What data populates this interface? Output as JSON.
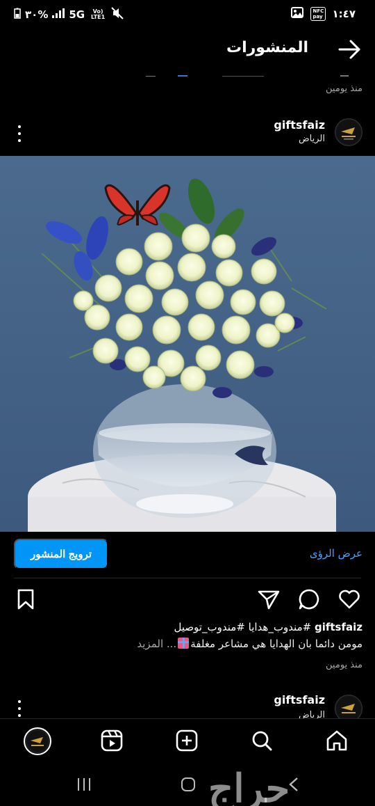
{
  "status_bar": {
    "time": "١:٤٧",
    "battery": "٣٠%",
    "network": "5G",
    "lte": "Vo) LTE1",
    "pay": "NFC pay"
  },
  "header": {
    "title": "المنشورات",
    "back_icon": "arrow-right-icon"
  },
  "previous_post": {
    "time": "منذ يومين"
  },
  "post": {
    "username": "giftsfaiz",
    "location": "الرياض",
    "promote_label": "ترويج المنشور",
    "insights_label": "عرض الرؤى",
    "caption_user": "giftsfaiz",
    "caption_tags": "#مندوب_هدايا #مندوب_توصيل",
    "caption_text": "مومن دائما بان الهدايا هي مشاعر مغلفة",
    "caption_more": "... المزيد",
    "time": "منذ يومين",
    "actions": [
      "heart-icon",
      "comment-icon",
      "share-icon",
      "bookmark-icon"
    ]
  },
  "next_post": {
    "username": "giftsfaiz",
    "location": "الرياض"
  },
  "bottom_nav": [
    "home-icon",
    "search-icon",
    "create-icon",
    "reels-icon",
    "profile-avatar"
  ],
  "watermark": "حراج",
  "colors": {
    "accent": "#0095f6",
    "link": "#4aa3ff",
    "background": "#000000",
    "muted": "#a8a8a8"
  }
}
